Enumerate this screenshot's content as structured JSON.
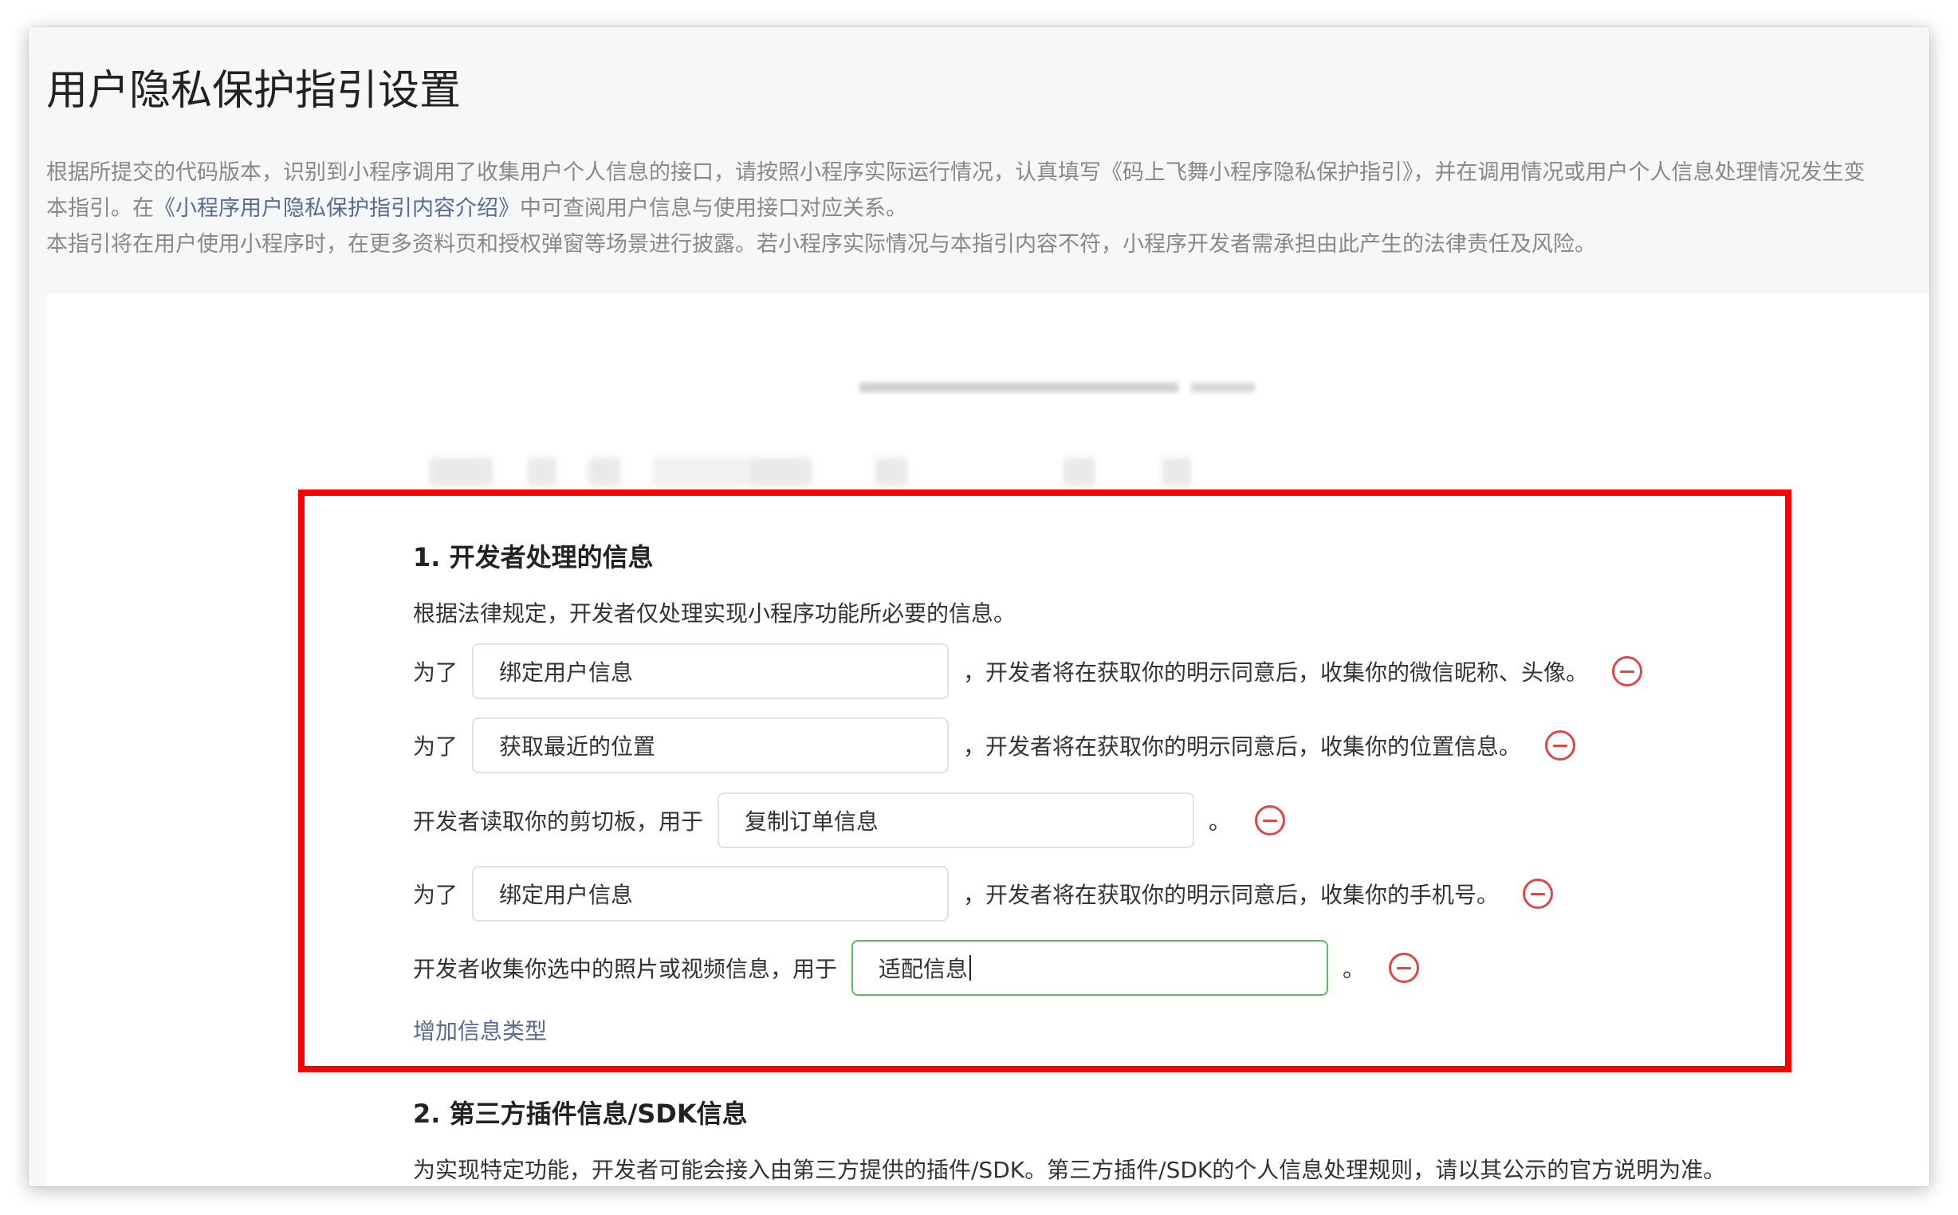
{
  "page": {
    "title": "用户隐私保护指引设置",
    "desc_line1": "根据所提交的代码版本，识别到小程序调用了收集用户个人信息的接口，请按照小程序实际运行情况，认真填写《码上飞舞小程序隐私保护指引》，并在调用情况或用户个人信息处理情况发生变",
    "desc_line2_prefix": "本指引。在",
    "desc_line2_link": "《小程序用户隐私保护指引内容介绍》",
    "desc_line2_suffix": "中可查阅用户信息与使用接口对应关系。",
    "desc_line3": "本指引将在用户使用小程序时，在更多资料页和授权弹窗等场景进行披露。若小程序实际情况与本指引内容不符，小程序开发者需承担由此产生的法律责任及风险。"
  },
  "section1": {
    "title": "1.  开发者处理的信息",
    "intro": "根据法律规定，开发者仅处理实现小程序功能所必要的信息。",
    "rows": [
      {
        "prefix": "为了",
        "value": "绑定用户信息",
        "suffix": "，开发者将在获取你的明示同意后，收集你的微信昵称、头像。"
      },
      {
        "prefix": "为了",
        "value": "获取最近的位置",
        "suffix": "，开发者将在获取你的明示同意后，收集你的位置信息。"
      },
      {
        "prefix": "开发者读取你的剪切板，用于",
        "value": "复制订单信息",
        "suffix": "。"
      },
      {
        "prefix": "为了",
        "value": "绑定用户信息",
        "suffix": "，开发者将在获取你的明示同意后，收集你的手机号。"
      },
      {
        "prefix": "开发者收集你选中的照片或视频信息，用于",
        "value": "适配信息",
        "suffix": "。"
      }
    ],
    "add_link": "增加信息类型"
  },
  "section2": {
    "title": "2.  第三方插件信息/SDK信息",
    "intro": "为实现特定功能，开发者可能会接入由第三方提供的插件/SDK。第三方插件/SDK的个人信息处理规则，请以其公示的官方说明为准。"
  },
  "colors": {
    "highlight_border": "#ff0000",
    "link": "#576b95",
    "remove_icon": "#e04646",
    "focused_input_border": "#5fb864"
  },
  "icons": {
    "remove": "minus-circle-icon"
  }
}
